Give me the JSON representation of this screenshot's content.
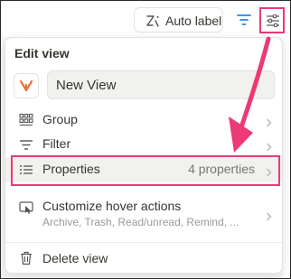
{
  "toolbar": {
    "auto_label": "Auto label",
    "auto_label_icon": "magic-wand-icon",
    "filter_icon": "filter-icon",
    "settings_icon": "sliders-icon"
  },
  "panel": {
    "title": "Edit view",
    "view_icon": "view-logo-icon",
    "view_name": "New View",
    "items": [
      {
        "label": "Group",
        "icon": "grid-icon",
        "value": ""
      },
      {
        "label": "Filter",
        "icon": "filter-lines-icon",
        "value": ""
      },
      {
        "label": "Properties",
        "icon": "list-icon",
        "value": "4 properties"
      }
    ],
    "hover": {
      "label": "Customize hover actions",
      "subtitle": "Archive, Trash, Read/unread, Remind, ...",
      "icon": "cursor-box-icon"
    },
    "delete": {
      "label": "Delete view",
      "icon": "trash-icon"
    }
  },
  "colors": {
    "highlight": "#ec3a74",
    "accent_blue": "#2f80ed",
    "logo_orange": "#e8743b"
  }
}
